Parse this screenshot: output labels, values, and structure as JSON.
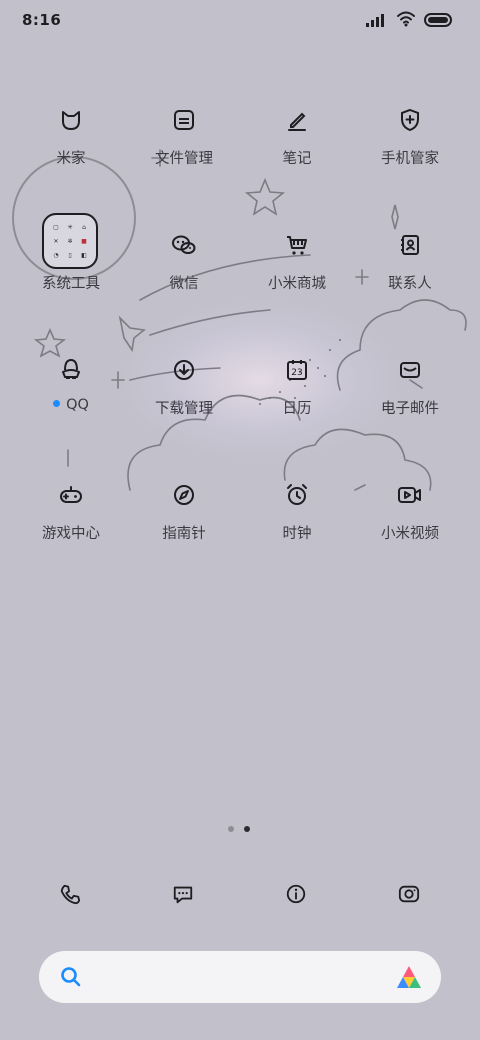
{
  "status_bar": {
    "time": "8:16"
  },
  "apps": [
    {
      "id": "mijia",
      "label": "米家",
      "icon": "mijia-icon"
    },
    {
      "id": "file-manager",
      "label": "文件管理",
      "icon": "folder-doc-icon"
    },
    {
      "id": "notes",
      "label": "笔记",
      "icon": "pen-icon"
    },
    {
      "id": "security",
      "label": "手机管家",
      "icon": "shield-icon"
    },
    {
      "id": "system-tools",
      "label": "系统工具",
      "icon": "folder-icon"
    },
    {
      "id": "wechat",
      "label": "微信",
      "icon": "wechat-icon"
    },
    {
      "id": "mi-store",
      "label": "小米商城",
      "icon": "cart-icon"
    },
    {
      "id": "contacts",
      "label": "联系人",
      "icon": "contacts-icon"
    },
    {
      "id": "qq",
      "label": "QQ",
      "icon": "penguin-icon",
      "badge": "new-dot"
    },
    {
      "id": "downloads",
      "label": "下载管理",
      "icon": "download-icon"
    },
    {
      "id": "calendar",
      "label": "日历",
      "icon": "calendar-icon",
      "calendar_day": "23"
    },
    {
      "id": "email",
      "label": "电子邮件",
      "icon": "mail-icon"
    },
    {
      "id": "game-center",
      "label": "游戏中心",
      "icon": "gamepad-icon"
    },
    {
      "id": "compass",
      "label": "指南针",
      "icon": "compass-icon"
    },
    {
      "id": "clock",
      "label": "时钟",
      "icon": "alarm-clock-icon"
    },
    {
      "id": "mi-video",
      "label": "小米视频",
      "icon": "video-icon"
    }
  ],
  "dock": [
    {
      "id": "phone",
      "icon": "phone-icon"
    },
    {
      "id": "messages",
      "icon": "message-icon"
    },
    {
      "id": "browser",
      "icon": "info-icon"
    },
    {
      "id": "camera",
      "icon": "camera-icon"
    }
  ],
  "page_indicator": {
    "count": 2,
    "active": 2
  },
  "colors": {
    "background": "#c2c1cb",
    "accent_dot": "#1a8cff",
    "icon_stroke": "#1e1e22"
  }
}
